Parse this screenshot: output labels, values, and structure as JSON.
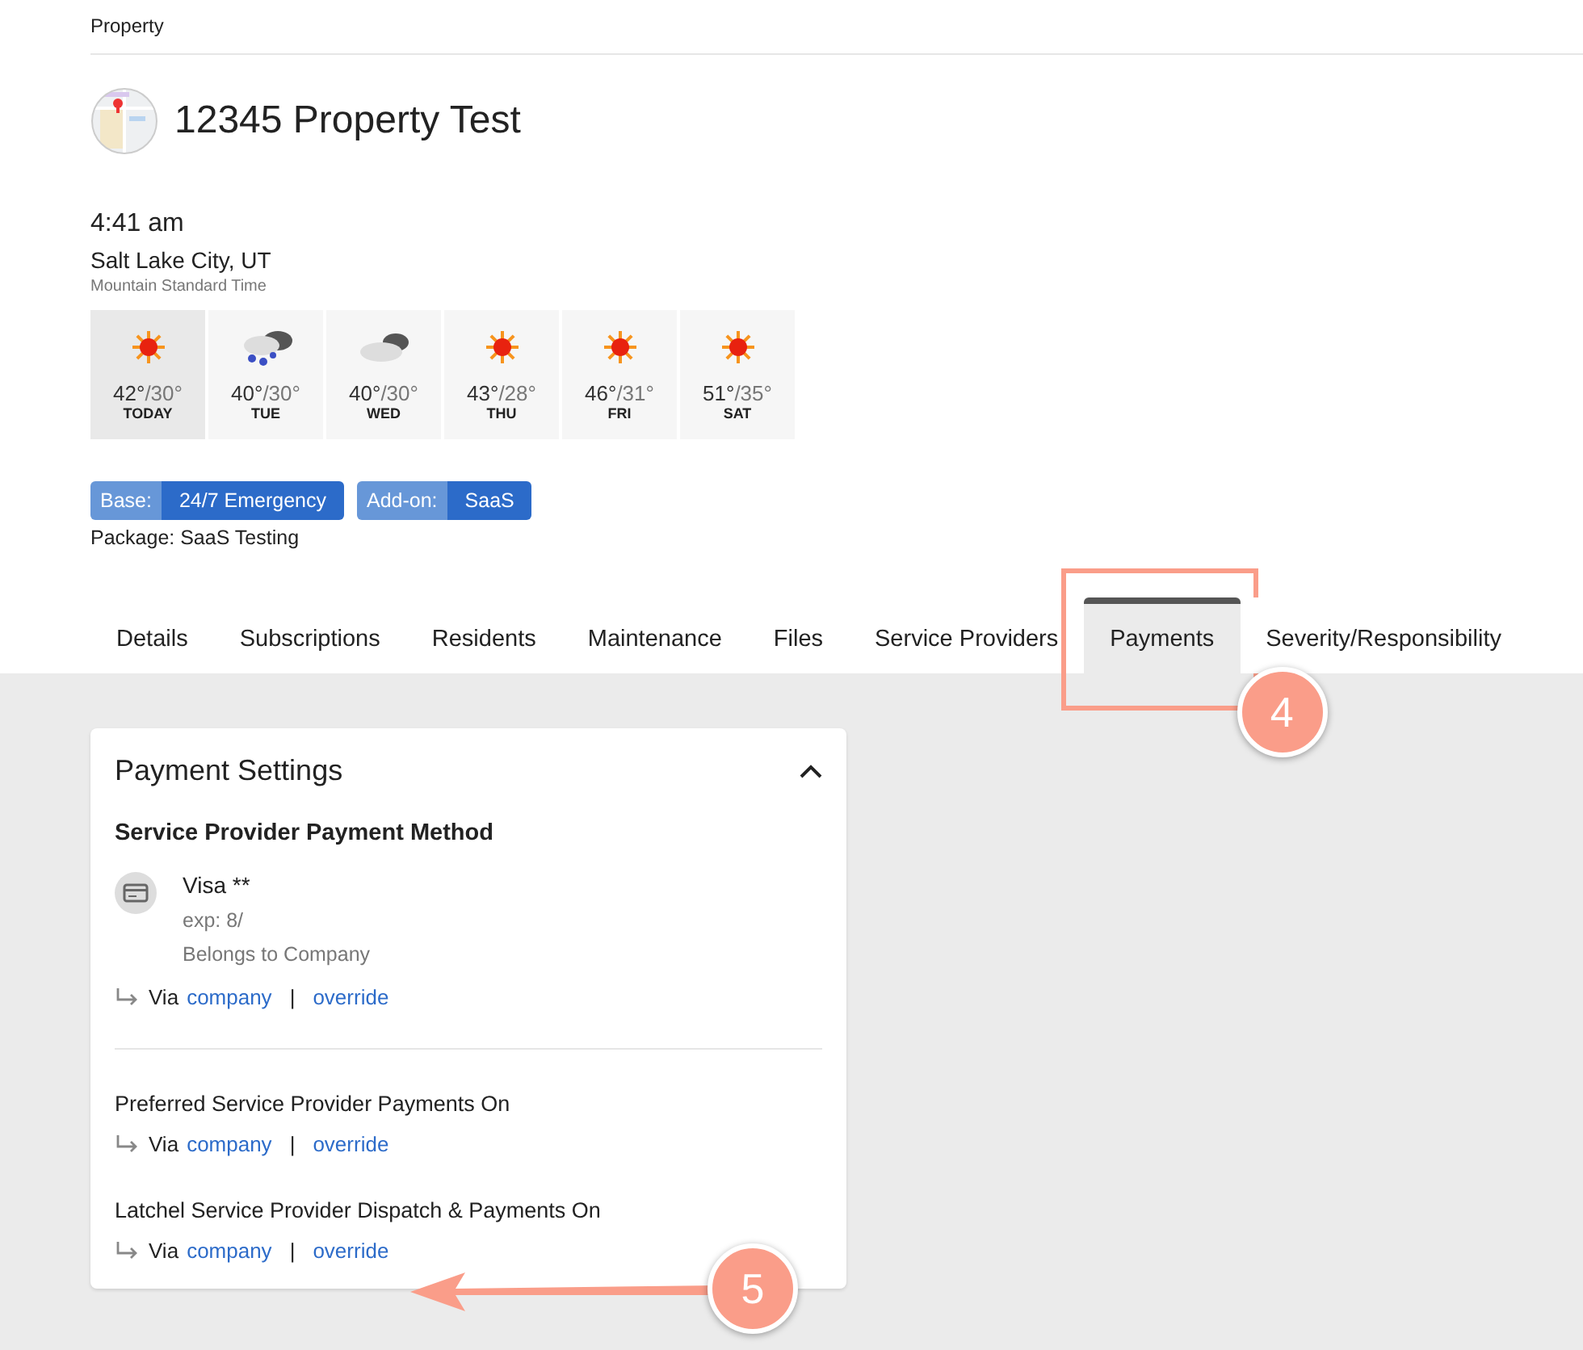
{
  "breadcrumb": "Property",
  "property": {
    "title": "12345 Property Test"
  },
  "clock": {
    "time": "4:41 am",
    "city": "Salt Lake City, UT",
    "timezone": "Mountain Standard Time"
  },
  "forecast": [
    {
      "kind": "sun",
      "high": "42°",
      "low": "/30°",
      "day": "TODAY",
      "selected": true
    },
    {
      "kind": "snow",
      "high": "40°",
      "low": "/30°",
      "day": "TUE",
      "selected": false
    },
    {
      "kind": "cloud",
      "high": "40°",
      "low": "/30°",
      "day": "WED",
      "selected": false
    },
    {
      "kind": "sun",
      "high": "43°",
      "low": "/28°",
      "day": "THU",
      "selected": false
    },
    {
      "kind": "sun",
      "high": "46°",
      "low": "/31°",
      "day": "FRI",
      "selected": false
    },
    {
      "kind": "sun",
      "high": "51°",
      "low": "/35°",
      "day": "SAT",
      "selected": false
    }
  ],
  "tags": [
    {
      "label": "Base:",
      "value": "24/7 Emergency"
    },
    {
      "label": "Add-on:",
      "value": "SaaS"
    }
  ],
  "package": "Package: SaaS Testing",
  "tabs": [
    {
      "label": "Details",
      "selected": false
    },
    {
      "label": "Subscriptions",
      "selected": false
    },
    {
      "label": "Residents",
      "selected": false
    },
    {
      "label": "Maintenance",
      "selected": false
    },
    {
      "label": "Files",
      "selected": false
    },
    {
      "label": "Service Providers",
      "selected": false
    },
    {
      "label": "Payments",
      "selected": true
    },
    {
      "label": "Severity/Responsibility",
      "selected": false
    }
  ],
  "card": {
    "title": "Payment Settings",
    "expanded": true,
    "method": {
      "heading": "Service Provider Payment Method",
      "card_name": "Visa **",
      "expiry": "exp: 8/",
      "owner": "Belongs to Company",
      "via": "Via",
      "source": "company",
      "separator": "|",
      "action": "override"
    },
    "settings": [
      {
        "label": "Preferred Service Provider Payments On",
        "via": "Via",
        "source": "company",
        "separator": "|",
        "action": "override"
      },
      {
        "label": "Latchel Service Provider Dispatch & Payments On",
        "via": "Via",
        "source": "company",
        "separator": "|",
        "action": "override"
      }
    ]
  },
  "callouts": [
    {
      "number": "4"
    },
    {
      "number": "5"
    }
  ]
}
